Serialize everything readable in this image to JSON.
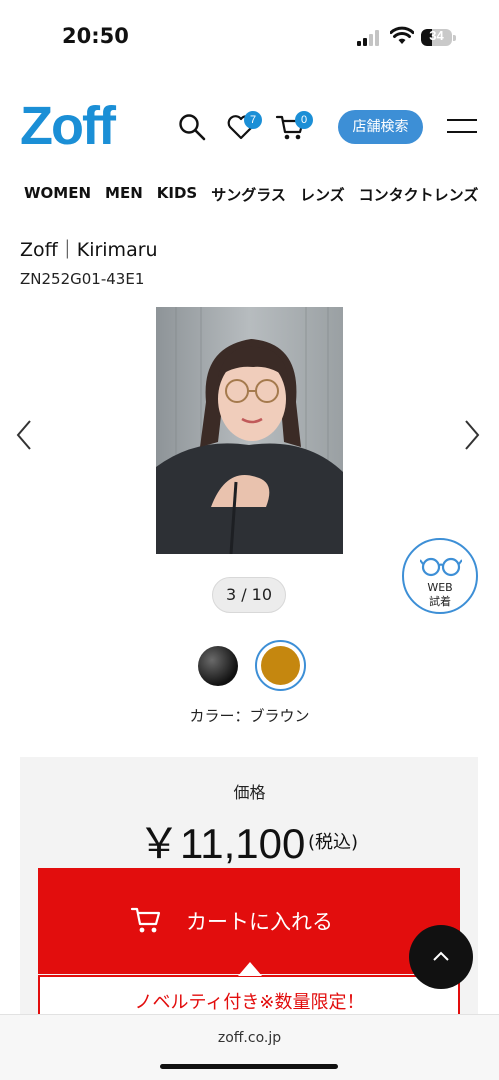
{
  "status_bar": {
    "time": "20:50",
    "battery": "34",
    "battery_level": 0.34
  },
  "header": {
    "logo": "Zoff",
    "favorites_count": "7",
    "cart_count": "0",
    "store_search_label": "店舗検索",
    "icons": [
      "search-icon",
      "heart-icon",
      "cart-icon",
      "menu-icon"
    ]
  },
  "nav": {
    "items": [
      {
        "label": "WOMEN"
      },
      {
        "label": "MEN"
      },
      {
        "label": "KIDS"
      },
      {
        "label": "サングラス"
      },
      {
        "label": "レンズ"
      },
      {
        "label": "コンタクトレンズ"
      }
    ]
  },
  "product": {
    "title": "Zoff｜Kirimaru",
    "code": "ZN252G01-43E1",
    "image_index": "3 / 10",
    "web_tryon_line1": "WEB",
    "web_tryon_line2": "試着",
    "color_label": "カラー：ブラウン",
    "swatches": [
      {
        "name": "black",
        "color": "#111111"
      },
      {
        "name": "brown",
        "color": "#c5870f",
        "selected": true
      }
    ]
  },
  "purchase": {
    "price_label": "価格",
    "price": "￥11,100",
    "tax_label": "(税込)",
    "cart_button_label": "カートに入れる",
    "novelty_text": "ノベルティ付き※数量限定！",
    "accent_color": "#e20d0d"
  },
  "browser": {
    "url": "zoff.co.jp"
  }
}
